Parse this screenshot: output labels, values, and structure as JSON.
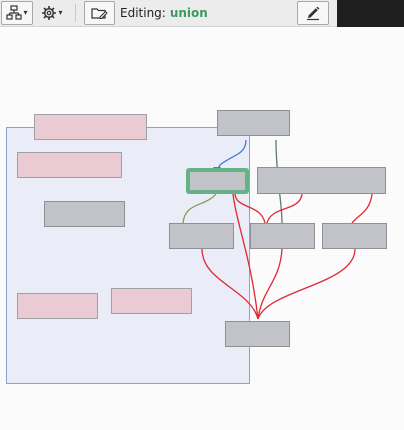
{
  "toolbar": {
    "layout_icon": "hierarchy-icon",
    "settings_icon": "gear-icon",
    "open_icon": "folder-edit-icon",
    "edit_icon": "pencil-icon",
    "editing_label": "Editing:",
    "editing_value": "union"
  },
  "colors": {
    "accent_green": "#3c9a63",
    "active_node_border": "#64b386",
    "edge_red": "#dd2a35",
    "edge_blue": "#3f7ad8",
    "edge_olive": "#8a9a52",
    "edge_teal": "#5b7a74",
    "selection_border": "#8da1d3"
  },
  "graph": {
    "nodes": [
      {
        "id": "p1",
        "kind": "pink"
      },
      {
        "id": "p2",
        "kind": "pink"
      },
      {
        "id": "g1",
        "kind": "gray"
      },
      {
        "id": "p3",
        "kind": "pink"
      },
      {
        "id": "p4",
        "kind": "pink"
      },
      {
        "id": "top",
        "kind": "gray"
      },
      {
        "id": "active",
        "kind": "active"
      },
      {
        "id": "wide",
        "kind": "gray"
      },
      {
        "id": "m1",
        "kind": "gray"
      },
      {
        "id": "m2",
        "kind": "gray"
      },
      {
        "id": "m3",
        "kind": "gray"
      },
      {
        "id": "bottom",
        "kind": "gray"
      }
    ]
  }
}
